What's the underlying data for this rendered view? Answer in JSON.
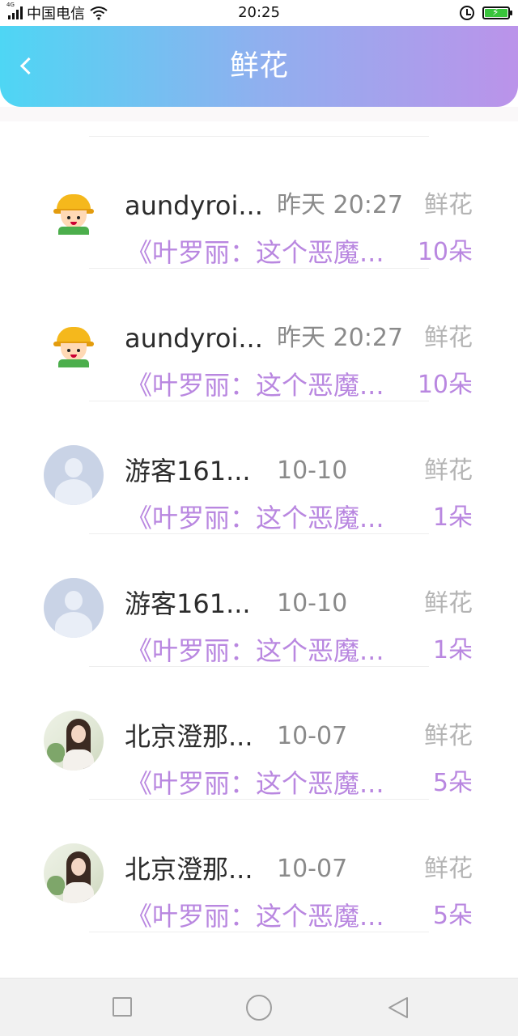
{
  "status_bar": {
    "network_tag": "4G",
    "carrier": "中国电信",
    "time": "20:25",
    "icons": [
      "signal-icon",
      "wifi-icon",
      "alarm-icon",
      "battery-charging-icon"
    ]
  },
  "header": {
    "title": "鲜花",
    "back_icon": "chevron-left-icon",
    "gradient": [
      "#4ed6f4",
      "#8fb0ef",
      "#bb93ea"
    ]
  },
  "items": [
    {
      "avatar": "cartoon",
      "name": "aundyroi...",
      "time": "昨天 20:27",
      "label": "鲜花",
      "book": "《叶罗丽：这个恶魔...",
      "count": "10朵"
    },
    {
      "avatar": "cartoon",
      "name": "aundyroi...",
      "time": "昨天 20:27",
      "label": "鲜花",
      "book": "《叶罗丽：这个恶魔...",
      "count": "10朵"
    },
    {
      "avatar": "default",
      "name": "游客161...",
      "time": "10-10",
      "label": "鲜花",
      "book": "《叶罗丽：这个恶魔...",
      "count": "1朵"
    },
    {
      "avatar": "default",
      "name": "游客161...",
      "time": "10-10",
      "label": "鲜花",
      "book": "《叶罗丽：这个恶魔...",
      "count": "1朵"
    },
    {
      "avatar": "photo",
      "name": "北京澄那...",
      "time": "10-07",
      "label": "鲜花",
      "book": "《叶罗丽：这个恶魔...",
      "count": "5朵"
    },
    {
      "avatar": "photo",
      "name": "北京澄那...",
      "time": "10-07",
      "label": "鲜花",
      "book": "《叶罗丽：这个恶魔...",
      "count": "5朵"
    }
  ],
  "colors": {
    "accent_purple": "#b987e0",
    "label_gray": "#b4b4b4",
    "time_gray": "#8a8a8a"
  },
  "nav_bar": {
    "icons": [
      "recent-apps-icon",
      "home-icon",
      "back-icon"
    ]
  }
}
